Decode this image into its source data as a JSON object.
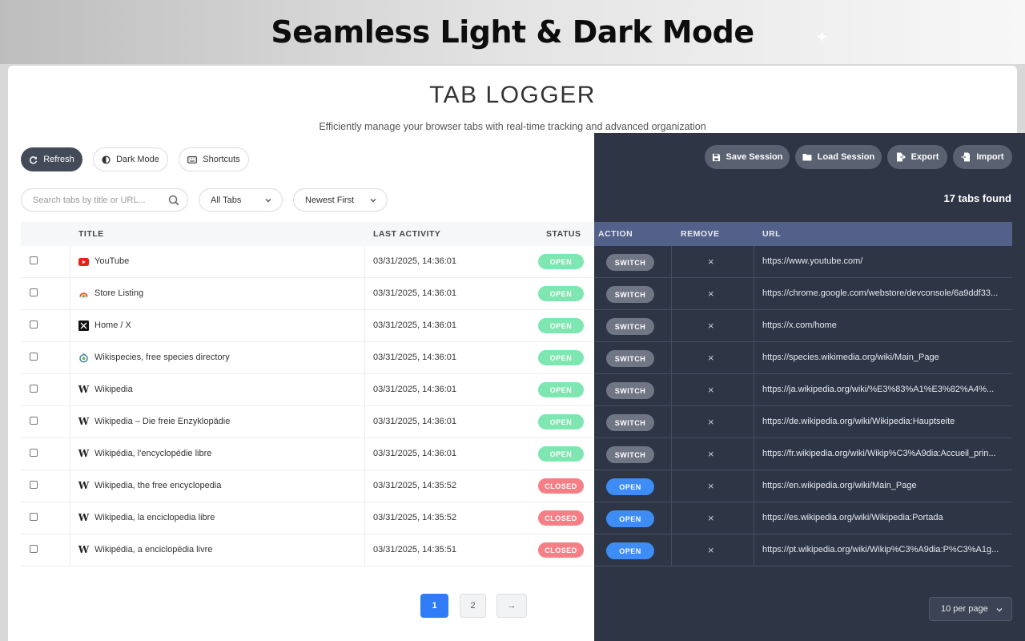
{
  "banner": {
    "title": "Seamless Light & Dark Mode"
  },
  "app": {
    "title": "TAB LOGGER",
    "subtitle": "Efficiently manage your browser tabs with real-time tracking and advanced organization"
  },
  "toolbar": {
    "refresh": "Refresh",
    "dark_mode": "Dark Mode",
    "shortcuts": "Shortcuts"
  },
  "panel_toolbar": {
    "save_session": "Save Session",
    "load_session": "Load Session",
    "export": "Export",
    "import": "Import"
  },
  "search": {
    "placeholder": "Search tabs by title or URL..."
  },
  "filters": {
    "tab_filter": "All Tabs",
    "sort": "Newest First"
  },
  "tabs_found": "17 tabs found",
  "columns": {
    "title": "TITLE",
    "last_activity": "LAST ACTIVITY",
    "status": "STATUS",
    "action": "ACTION",
    "remove": "REMOVE",
    "url": "URL"
  },
  "rows": [
    {
      "icon": "youtube-icon",
      "title": "YouTube",
      "time": "03/31/2025, 14:36:01",
      "status": "OPEN",
      "action": "SWITCH",
      "remove": "×",
      "url": "https://www.youtube.com/"
    },
    {
      "icon": "chrome-webstore-icon",
      "title": "Store Listing",
      "time": "03/31/2025, 14:36:01",
      "status": "OPEN",
      "action": "SWITCH",
      "remove": "×",
      "url": "https://chrome.google.com/webstore/devconsole/6a9ddf33..."
    },
    {
      "icon": "x-icon",
      "title": "Home / X",
      "time": "03/31/2025, 14:36:01",
      "status": "OPEN",
      "action": "SWITCH",
      "remove": "×",
      "url": "https://x.com/home"
    },
    {
      "icon": "wikispecies-icon",
      "title": "Wikispecies, free species directory",
      "time": "03/31/2025, 14:36:01",
      "status": "OPEN",
      "action": "SWITCH",
      "remove": "×",
      "url": "https://species.wikimedia.org/wiki/Main_Page"
    },
    {
      "icon": "wikipedia-icon",
      "title": "Wikipedia",
      "time": "03/31/2025, 14:36:01",
      "status": "OPEN",
      "action": "SWITCH",
      "remove": "×",
      "url": "https://ja.wikipedia.org/wiki/%E3%83%A1%E3%82%A4%..."
    },
    {
      "icon": "wikipedia-icon",
      "title": "Wikipedia – Die freie Enzyklopädie",
      "time": "03/31/2025, 14:36:01",
      "status": "OPEN",
      "action": "SWITCH",
      "remove": "×",
      "url": "https://de.wikipedia.org/wiki/Wikipedia:Hauptseite"
    },
    {
      "icon": "wikipedia-icon",
      "title": "Wikipédia, l'encyclopédie libre",
      "time": "03/31/2025, 14:36:01",
      "status": "OPEN",
      "action": "SWITCH",
      "remove": "×",
      "url": "https://fr.wikipedia.org/wiki/Wikip%C3%A9dia:Accueil_prin..."
    },
    {
      "icon": "wikipedia-icon",
      "title": "Wikipedia, the free encyclopedia",
      "time": "03/31/2025, 14:35:52",
      "status": "CLOSED",
      "action": "OPEN",
      "remove": "×",
      "url": "https://en.wikipedia.org/wiki/Main_Page"
    },
    {
      "icon": "wikipedia-icon",
      "title": "Wikipedia, la enciclopedia libre",
      "time": "03/31/2025, 14:35:52",
      "status": "CLOSED",
      "action": "OPEN",
      "remove": "×",
      "url": "https://es.wikipedia.org/wiki/Wikipedia:Portada"
    },
    {
      "icon": "wikipedia-icon",
      "title": "Wikipédia, a enciclopédia livre",
      "time": "03/31/2025, 14:35:51",
      "status": "CLOSED",
      "action": "OPEN",
      "remove": "×",
      "url": "https://pt.wikipedia.org/wiki/Wikip%C3%A9dia:P%C3%A1g..."
    }
  ],
  "pagination": {
    "pages": [
      "1",
      "2"
    ],
    "next": "→",
    "current": "1",
    "per_page": "10 per page"
  },
  "colors": {
    "open": "#7ee6b0",
    "closed": "#f47f86",
    "switch": "#707684",
    "open_action": "#3d8df5",
    "dark_panel": "#2e3646"
  }
}
